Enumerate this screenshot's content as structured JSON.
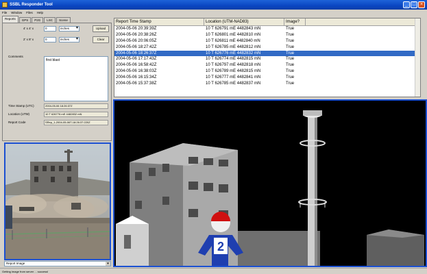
{
  "window": {
    "title": "SSBL Responder Tool",
    "buttons": {
      "minimize": "_",
      "maximize": "□",
      "close": "×"
    }
  },
  "menu": [
    "File",
    "Window",
    "Files",
    "Help"
  ],
  "tabs": [
    "Reports",
    "GPS",
    "P2G",
    "LSC",
    "Scene"
  ],
  "form": {
    "row1_label": "4' x 4' x",
    "row1_value": "0",
    "row1_unit": "inches",
    "row2_label": "2' x 8' x",
    "row2_value": "0",
    "row2_unit": "inches",
    "upload_label": "Upload",
    "clear_label": "Clear",
    "comments_label": "Comments",
    "comments_value": "first blast",
    "timestamp_label": "Time Stamp (UTC)",
    "timestamp_value": "2004-05-06 18:26:37Z",
    "location_label": "Location (UTM)",
    "location_value": "10 T 626776 mE 4482832 mN",
    "reportcode_label": "Report Code",
    "reportcode_value": "SRep_1-2004-05-06T-18:26:37:220Z"
  },
  "report_image_select": "Report Image",
  "status_text": "Getting image from server ... success!",
  "table": {
    "headers": [
      "Report Time Stamp",
      "Location (UTM-NAD83)",
      "Image?"
    ],
    "rows": [
      [
        "2004-05-06 20:39:39Z",
        "10 T 626791 mE 4482843 mN",
        "True"
      ],
      [
        "2004-05-06 20:38:26Z",
        "10 T 626801 mE 4482810 mN",
        "True"
      ],
      [
        "2004-05-06 20:06:05Z",
        "10 T 626811 mE 4482840 mN",
        "True"
      ],
      [
        "2004-05-06 18:27:42Z",
        "10 T 626785 mE 4482812 mN",
        "True"
      ],
      [
        "2004-05-06 18:26:37Z",
        "10 T 626776 mE 4482832 mN",
        "True"
      ],
      [
        "2004-05-06 17:17:43Z",
        "10 T 626774 mE 4482815 mN",
        "True"
      ],
      [
        "2004-05-06 16:58:42Z",
        "10 T 626797 mE 4482818 mN",
        "True"
      ],
      [
        "2004-05-06 16:38:03Z",
        "10 T 626789 mE 4482815 mN",
        "True"
      ],
      [
        "2004-05-06 16:15:34Z",
        "10 T 626777 mE 4482841 mN",
        "True"
      ],
      [
        "2004-05-06 15:37:38Z",
        "10 T 626785 mE 4482837 mN",
        "True"
      ]
    ],
    "selected_index": 4
  },
  "scene": {
    "marker_number": "2"
  }
}
